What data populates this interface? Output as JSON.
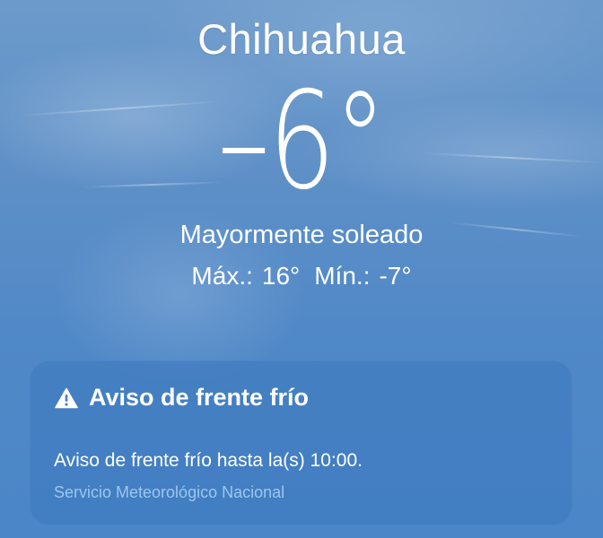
{
  "location": {
    "city": "Chihuahua",
    "temperature": "–6°",
    "condition": "Mayormente soleado",
    "high_label": "Máx.:",
    "high_value": "16°",
    "low_label": "Mín.:",
    "low_value": "-7°"
  },
  "alert": {
    "icon": "warning-triangle-icon",
    "title": "Aviso de frente frío",
    "body": "Aviso de frente frío hasta la(s) 10:00.",
    "source": "Servicio Meteorológico Nacional"
  },
  "colors": {
    "background": "#5189c7",
    "card": "#3c78be",
    "source_text": "#9cc6ef"
  }
}
